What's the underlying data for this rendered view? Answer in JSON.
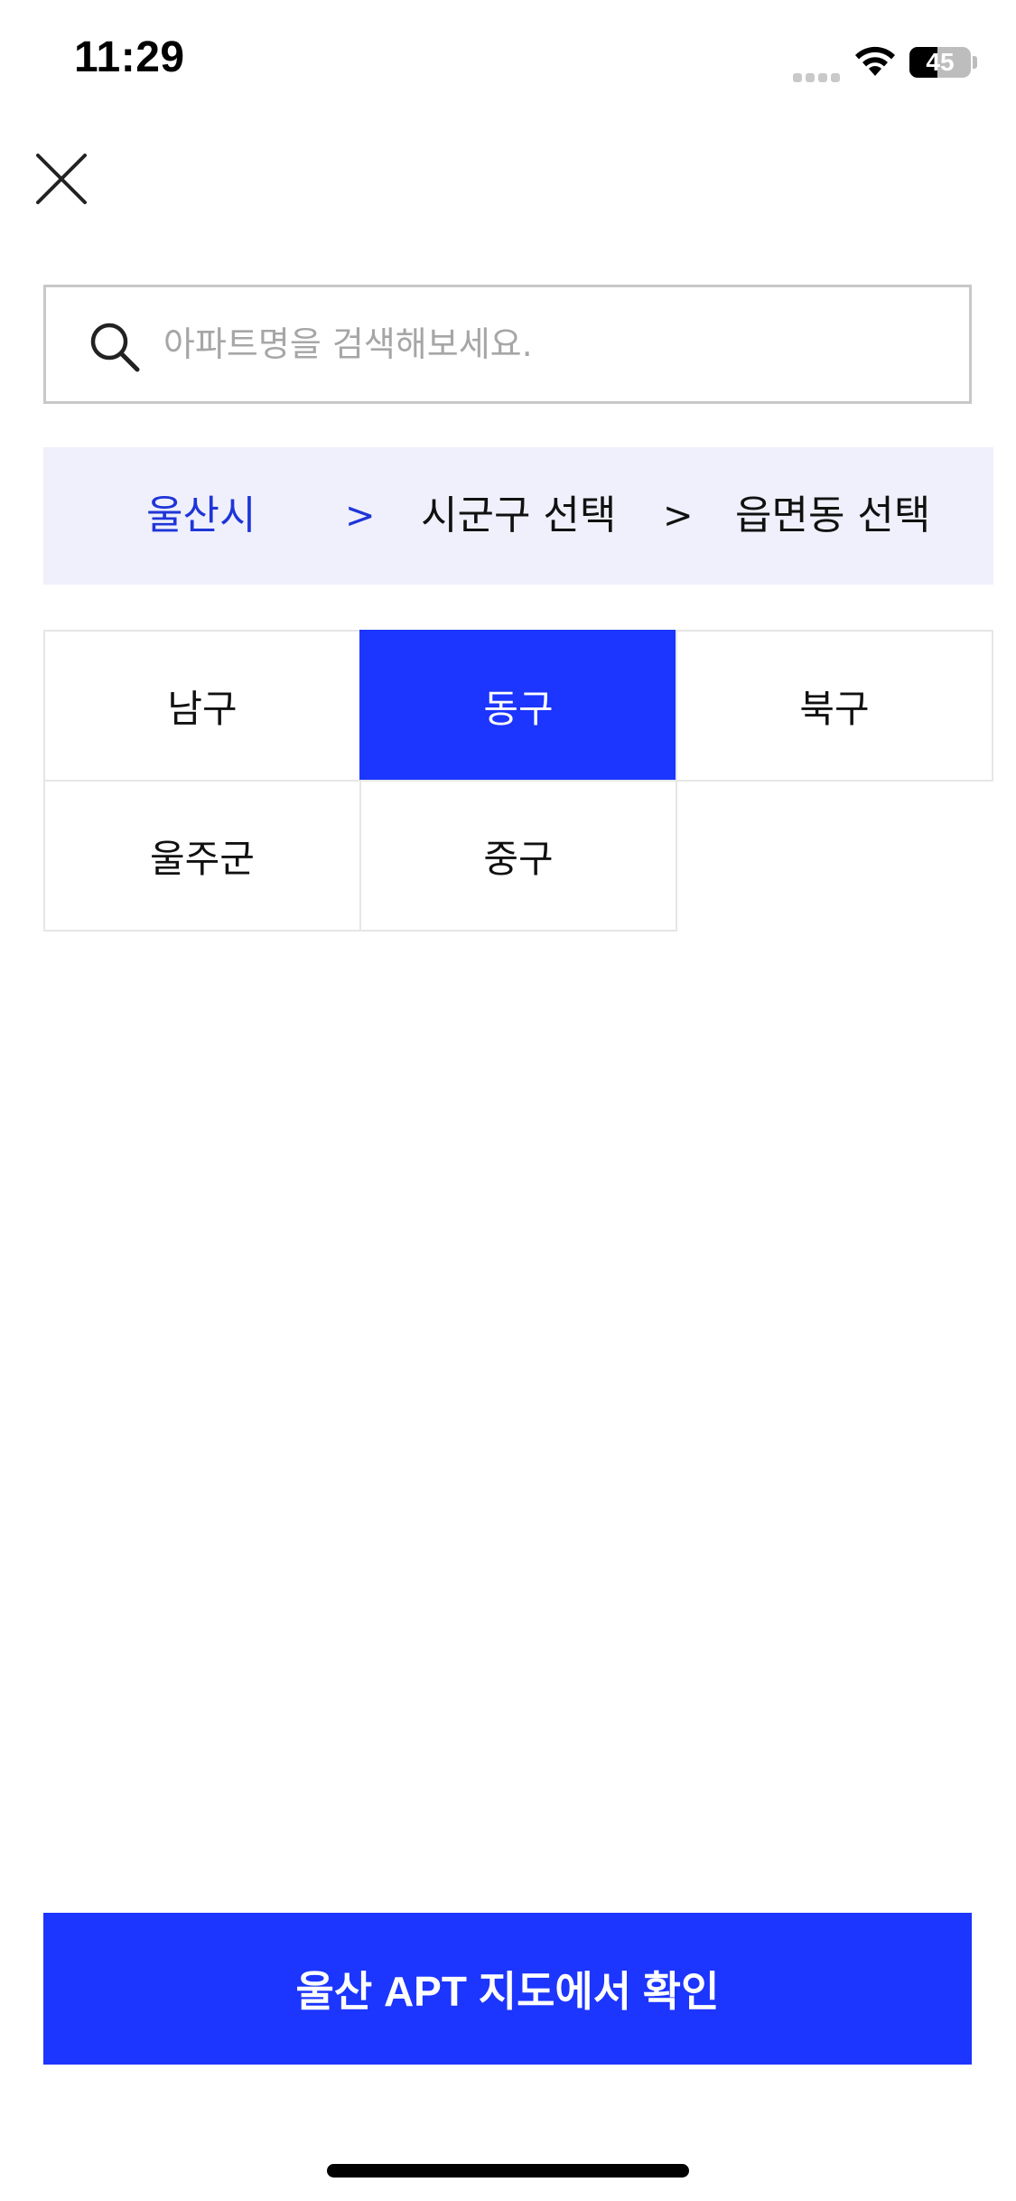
{
  "status_bar": {
    "time": "11:29",
    "battery_level": "45",
    "battery_fraction": 0.45
  },
  "search": {
    "placeholder": "아파트명을 검색해보세요.",
    "value": ""
  },
  "breadcrumb": {
    "city": "울산시",
    "separator_1": ">",
    "district": "시군구 선택",
    "separator_2": ">",
    "town": "읍면동 선택"
  },
  "districts": [
    {
      "label": "남구",
      "selected": false
    },
    {
      "label": "동구",
      "selected": true
    },
    {
      "label": "북구",
      "selected": false
    },
    {
      "label": "울주군",
      "selected": false
    },
    {
      "label": "중구",
      "selected": false
    }
  ],
  "confirm_button": {
    "label": "울산 APT 지도에서 확인"
  },
  "colors": {
    "accent": "#1c35ff",
    "breadcrumb_active": "#1f35d8",
    "breadcrumb_bg": "#eff0fb"
  }
}
